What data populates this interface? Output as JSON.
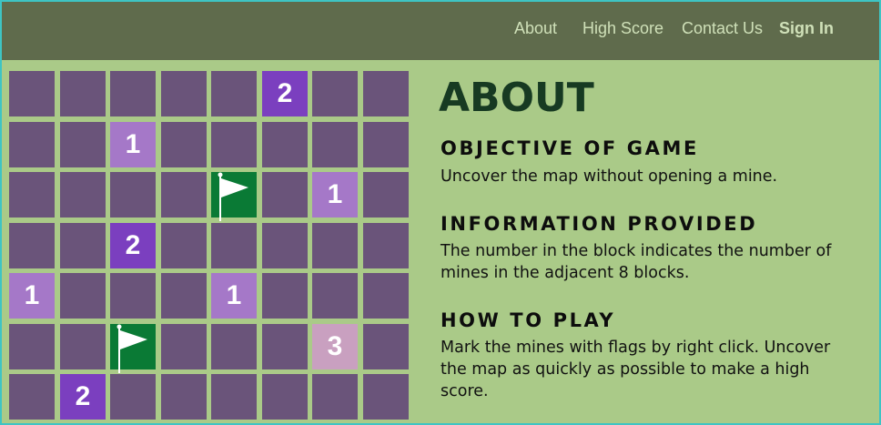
{
  "nav": {
    "about": "About",
    "high_score": "High Score",
    "contact": "Contact Us",
    "sign_in": "Sign In"
  },
  "colors": {
    "page_bg": "#aaca88",
    "navbar_bg": "#5f6b4c",
    "hidden_cell": "#6a547a",
    "revealed_1": "#a578c8",
    "revealed_2": "#7b3fbf",
    "revealed_3": "#c9a0c0",
    "flag_cell": "#0a7a35",
    "border": "#3ec4c4"
  },
  "board": {
    "rows": 7,
    "cols": 8,
    "cells": [
      {
        "row": 0,
        "col": 5,
        "type": "number",
        "value": "2"
      },
      {
        "row": 1,
        "col": 2,
        "type": "number",
        "value": "1"
      },
      {
        "row": 2,
        "col": 4,
        "type": "flag",
        "icon": "flag-icon"
      },
      {
        "row": 2,
        "col": 6,
        "type": "number",
        "value": "1"
      },
      {
        "row": 3,
        "col": 2,
        "type": "number",
        "value": "2"
      },
      {
        "row": 4,
        "col": 0,
        "type": "number",
        "value": "1"
      },
      {
        "row": 4,
        "col": 4,
        "type": "number",
        "value": "1"
      },
      {
        "row": 5,
        "col": 2,
        "type": "flag",
        "icon": "flag-icon"
      },
      {
        "row": 5,
        "col": 6,
        "type": "number",
        "value": "3"
      },
      {
        "row": 6,
        "col": 1,
        "type": "number",
        "value": "2"
      }
    ]
  },
  "about": {
    "title": "ABOUT",
    "sections": [
      {
        "heading": "OBJECTIVE OF GAME",
        "body": "Uncover the map without opening a mine."
      },
      {
        "heading": "INFORMATION PROVIDED",
        "body": "The number in the block indicates the number of mines in the adjacent 8 blocks."
      },
      {
        "heading": "HOW TO PLAY",
        "body": "Mark the mines with flags by right click. Uncover the map as quickly as possible to make a high score."
      }
    ]
  }
}
